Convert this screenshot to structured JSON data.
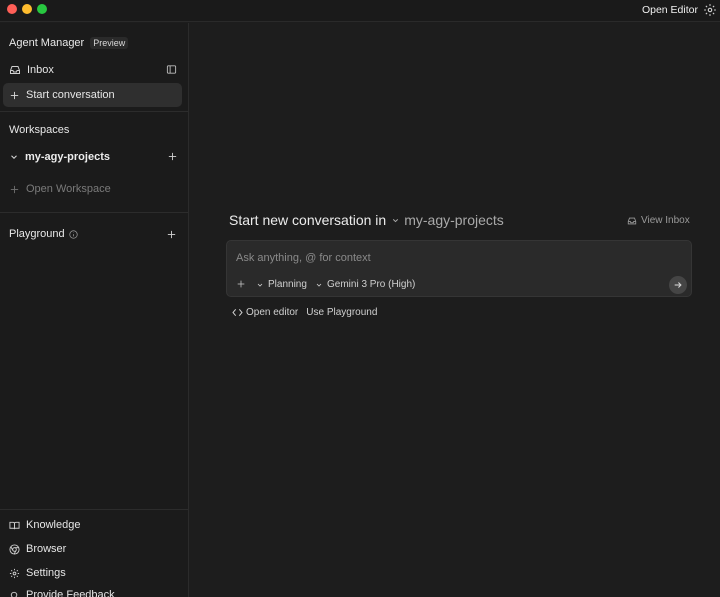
{
  "titlebar": {
    "open_editor_label": "Open Editor"
  },
  "sidebar": {
    "title": "Agent Manager",
    "badge": "Preview",
    "inbox_label": "Inbox",
    "start_label": "Start conversation",
    "workspaces_label": "Workspaces",
    "workspace_name": "my-agy-projects",
    "open_workspace_label": "Open Workspace",
    "playground_label": "Playground",
    "bottom_items": {
      "knowledge": "Knowledge",
      "browser": "Browser",
      "settings": "Settings",
      "feedback": "Provide Feedback"
    }
  },
  "main": {
    "title_lead": "Start new conversation in",
    "title_project": "my-agy-projects",
    "view_inbox_label": "View Inbox",
    "prompt_placeholder": "Ask anything, @ for context",
    "mode_label": "Planning",
    "model_label": "Gemini 3 Pro (High)",
    "open_editor_link": "Open editor",
    "use_playground_link": "Use Playground"
  },
  "icons": {
    "titlebar": [
      "gear-icon"
    ],
    "sidebar": [
      "inbox-icon",
      "sidebar-panel-icon",
      "plus-icon",
      "chevron-down-icon",
      "info-icon",
      "book-icon",
      "chrome-icon",
      "gear-icon",
      "feedback-icon"
    ],
    "main": [
      "chevron-down-icon",
      "inbox-icon",
      "plus-icon",
      "arrow-right-icon",
      "code-icon"
    ]
  },
  "colors": {
    "background": "#1d1d1d",
    "sidebar": "#1b1b1b",
    "active_row": "#2f2f2f",
    "prompt_box": "#2a2a2a",
    "text": "#e6e6e6",
    "muted": "#8a8a8a",
    "traffic_close": "#ff5f57",
    "traffic_min": "#febc2e",
    "traffic_max": "#28c840"
  }
}
